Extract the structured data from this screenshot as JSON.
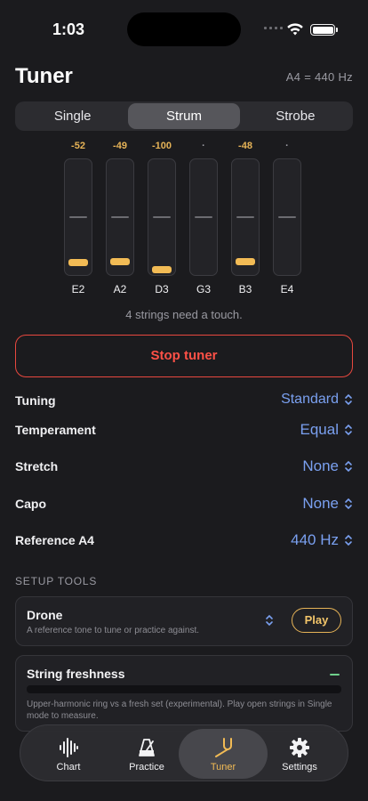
{
  "status": {
    "time": "1:03"
  },
  "header": {
    "title": "Tuner",
    "reference": "A4 = 440 Hz"
  },
  "modes": [
    {
      "label": "Single",
      "active": false
    },
    {
      "label": "Strum",
      "active": true
    },
    {
      "label": "Strobe",
      "active": false
    }
  ],
  "strings": [
    {
      "note": "E2",
      "cents": "-52",
      "offset": -52
    },
    {
      "note": "A2",
      "cents": "-49",
      "offset": -49
    },
    {
      "note": "D3",
      "cents": "-100",
      "offset": -100
    },
    {
      "note": "G3",
      "cents": "·",
      "offset": null
    },
    {
      "note": "B3",
      "cents": "-48",
      "offset": -48
    },
    {
      "note": "E4",
      "cents": "·",
      "offset": null
    }
  ],
  "hint": "4 strings need a touch.",
  "stop_label": "Stop tuner",
  "settings": {
    "tuning": {
      "label": "Tuning",
      "value": "Standard"
    },
    "temperament": {
      "label": "Temperament",
      "value": "Equal"
    },
    "stretch": {
      "label": "Stretch",
      "value": "None"
    },
    "capo": {
      "label": "Capo",
      "value": "None"
    },
    "reference": {
      "label": "Reference A4",
      "value": "440 Hz"
    }
  },
  "setup": {
    "header": "SETUP TOOLS",
    "drone": {
      "title": "Drone",
      "subtitle": "A reference tone to tune or practice against.",
      "play_label": "Play"
    },
    "freshness": {
      "title": "String freshness",
      "description": "Upper-harmonic ring vs a fresh set (experimental). Play open strings in Single mode to measure."
    }
  },
  "tabs": [
    {
      "label": "Chart",
      "icon": "waveform-icon",
      "active": false
    },
    {
      "label": "Practice",
      "icon": "metronome-icon",
      "active": false
    },
    {
      "label": "Tuner",
      "icon": "tuning-fork-icon",
      "active": true
    },
    {
      "label": "Settings",
      "icon": "gear-icon",
      "active": false
    }
  ],
  "colors": {
    "accent": "#f2bb55",
    "link": "#7aa0f0",
    "danger": "#ff5147",
    "good": "#6fd08c",
    "background": "#1b1b1e"
  }
}
